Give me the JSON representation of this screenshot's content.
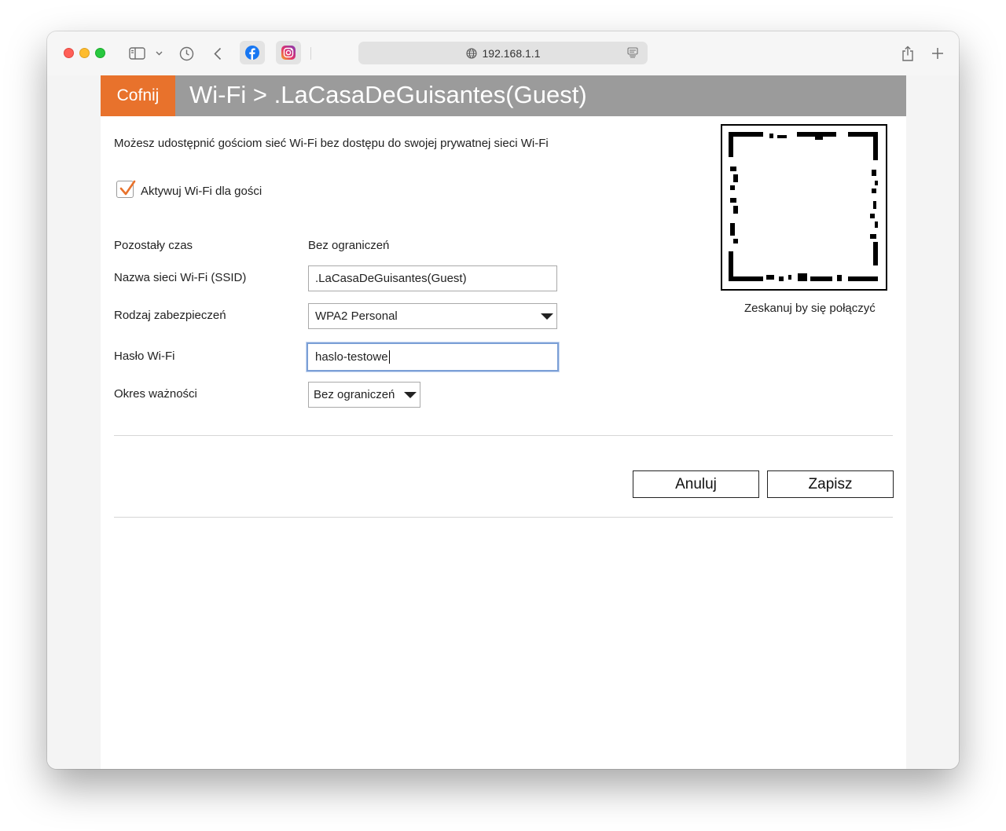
{
  "browser": {
    "url": "192.168.1.1",
    "bookmarks": [
      {
        "name": "facebook-icon",
        "color": "#1877f2"
      },
      {
        "name": "instagram-icon",
        "color": "#e1306c"
      }
    ]
  },
  "header": {
    "back_label": "Cofnij",
    "title": "Wi-Fi > .LaCasaDeGuisantes(Guest)",
    "accent_color": "#e8722c",
    "bar_color": "#9b9b9b"
  },
  "intro": "Możesz udostępnić gościom sieć Wi-Fi bez dostępu do swojej prywatnej sieci Wi-Fi",
  "guest_toggle": {
    "label": "Aktywuj Wi-Fi dla gości",
    "checked": true
  },
  "form": {
    "remaining_time": {
      "label": "Pozostały czas",
      "value": "Bez ograniczeń"
    },
    "ssid": {
      "label": "Nazwa sieci Wi-Fi (SSID)",
      "value": ".LaCasaDeGuisantes(Guest)"
    },
    "security": {
      "label": "Rodzaj zabezpieczeń",
      "value": "WPA2 Personal"
    },
    "password": {
      "label": "Hasło Wi-Fi",
      "value": "haslo-testowe"
    },
    "validity": {
      "label": "Okres ważności",
      "value": "Bez ograniczeń"
    }
  },
  "qr": {
    "caption": "Zeskanuj by się połączyć"
  },
  "actions": {
    "cancel": "Anuluj",
    "save": "Zapisz"
  }
}
